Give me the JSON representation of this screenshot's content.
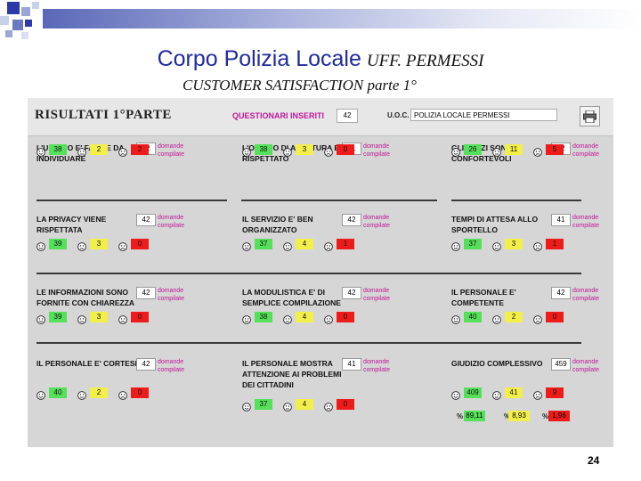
{
  "header": {
    "title": "Corpo Polizia Locale",
    "office": "UFF. PERMESSI",
    "subtitle": "CUSTOMER SATISFACTION parte 1°"
  },
  "panel": {
    "results_title": "RISULTATI 1°PARTE",
    "questionnaires_label": "QUESTIONARI INSERITI",
    "questionnaires_count": "42",
    "uoc_label": "U.O.C.",
    "uoc_value": "POLIZIA LOCALE PERMESSI",
    "print_icon": "printer-icon"
  },
  "questions": [
    {
      "text": "L'UFFICIO E' FACILE DA INDIVIDUARE",
      "count": "42",
      "dc_line1": "domande",
      "dc_line2": "compilate",
      "good": "38",
      "neutral": "2",
      "bad": "2"
    },
    {
      "text": "L'ORARIO DI APERTURA E' RISPETTATO",
      "count": "41",
      "dc_line1": "domande",
      "dc_line2": "compilate",
      "good": "38",
      "neutral": "3",
      "bad": "0"
    },
    {
      "text": "GLI SPAZI SONO CONFORTEVOLI",
      "count": "42",
      "dc_line1": "domande",
      "dc_line2": "compilate",
      "good": "26",
      "neutral": "11",
      "bad": "5"
    },
    {
      "text": "LA PRIVACY VIENE RISPETTATA",
      "count": "42",
      "dc_line1": "domande",
      "dc_line2": "compilate",
      "good": "39",
      "neutral": "3",
      "bad": "0"
    },
    {
      "text": "IL SERVIZIO E' BEN ORGANIZZATO",
      "count": "42",
      "dc_line1": "domande",
      "dc_line2": "compilate",
      "good": "37",
      "neutral": "4",
      "bad": "1"
    },
    {
      "text": "TEMPI DI ATTESA ALLO SPORTELLO",
      "count": "41",
      "dc_line1": "domande",
      "dc_line2": "compilate",
      "good": "37",
      "neutral": "3",
      "bad": "1"
    },
    {
      "text": "LE INFORMAZIONI SONO FORNITE CON CHIAREZZA",
      "count": "42",
      "dc_line1": "domande",
      "dc_line2": "compilate",
      "good": "39",
      "neutral": "3",
      "bad": "0"
    },
    {
      "text": "LA MODULISTICA E' DI SEMPLICE COMPILAZIONE",
      "count": "42",
      "dc_line1": "domande",
      "dc_line2": "compilate",
      "good": "38",
      "neutral": "4",
      "bad": "0"
    },
    {
      "text": "IL PERSONALE E' COMPETENTE",
      "count": "42",
      "dc_line1": "domande",
      "dc_line2": "compilate",
      "good": "40",
      "neutral": "2",
      "bad": "0"
    },
    {
      "text": "IL PERSONALE E' CORTESE",
      "count": "42",
      "dc_line1": "domande",
      "dc_line2": "compilate",
      "good": "40",
      "neutral": "2",
      "bad": "0"
    },
    {
      "text": "IL PERSONALE MOSTRA ATTENZIONE AI PROBLEMI DEI CITTADINI",
      "count": "41",
      "dc_line1": "domande",
      "dc_line2": "compilate",
      "good": "37",
      "neutral": "4",
      "bad": "0"
    },
    {
      "text": "GIUDIZIO COMPLESSIVO",
      "count": "459",
      "dc_line1": "domande",
      "dc_line2": "compilate",
      "good": "409",
      "neutral": "41",
      "bad": "9"
    }
  ],
  "percentages": {
    "symbol": "%",
    "good": "89,11",
    "neutral": "8,93",
    "bad": "1,96"
  },
  "colors": {
    "good": "#55e05a",
    "neutral": "#f2ef4a",
    "bad": "#ee1b1b",
    "accent": "#c0169a",
    "title": "#1f2aa0"
  },
  "page_number": "24"
}
